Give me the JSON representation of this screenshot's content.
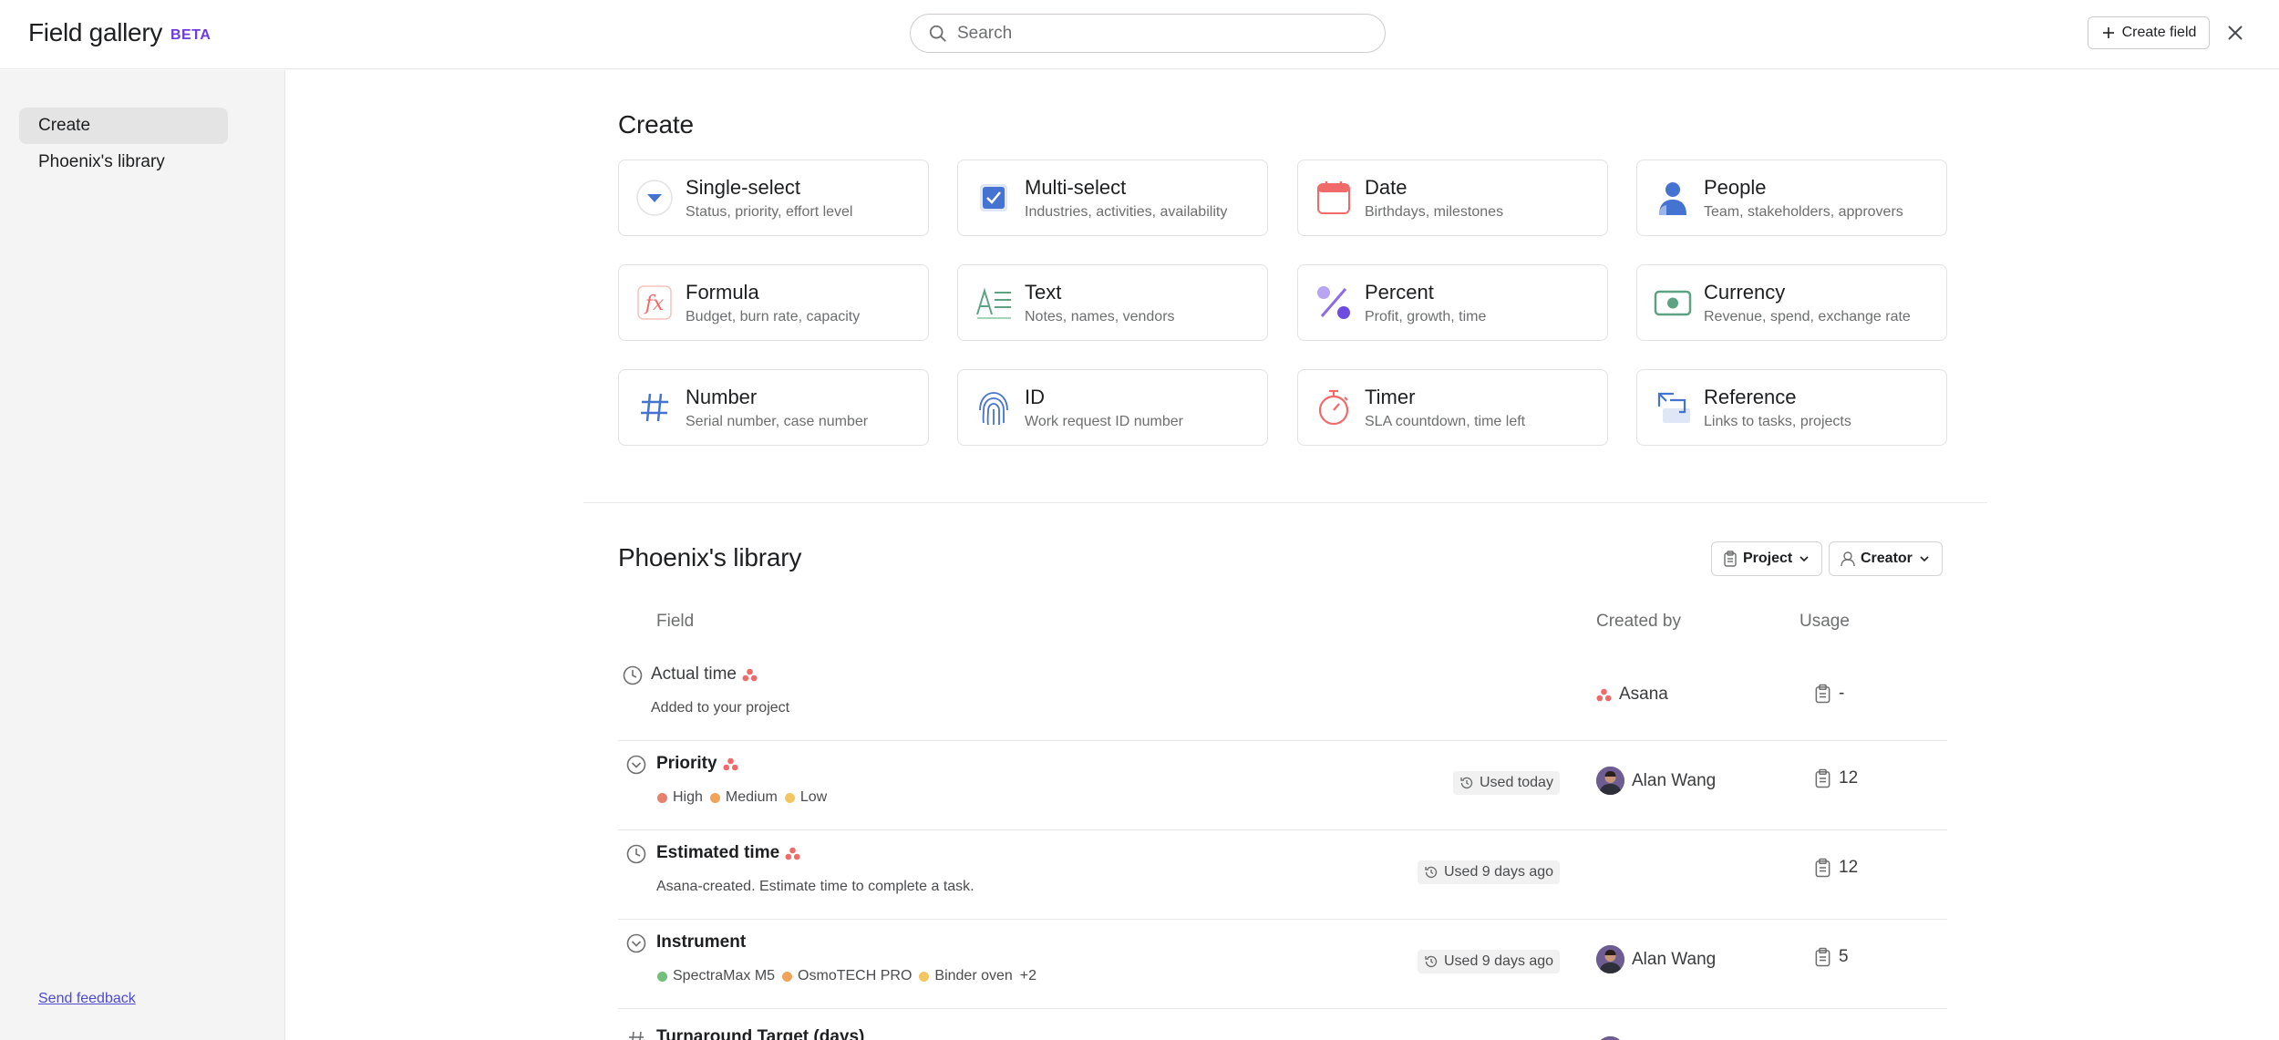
{
  "header": {
    "title": "Field gallery",
    "badge": "BETA",
    "search_placeholder": "Search",
    "create_field_label": "Create field"
  },
  "sidebar": {
    "items": [
      {
        "label": "Create",
        "active": true
      },
      {
        "label": "Phoenix's library",
        "active": false
      }
    ],
    "feedback_label": "Send feedback"
  },
  "create_section": {
    "title": "Create",
    "cards": [
      {
        "name": "Single-select",
        "desc": "Status, priority, effort level",
        "icon": "single-select-icon"
      },
      {
        "name": "Multi-select",
        "desc": "Industries, activities, availability",
        "icon": "multi-select-icon"
      },
      {
        "name": "Date",
        "desc": "Birthdays, milestones",
        "icon": "calendar-icon"
      },
      {
        "name": "People",
        "desc": "Team, stakeholders, approvers",
        "icon": "person-icon"
      },
      {
        "name": "Formula",
        "desc": "Budget, burn rate, capacity",
        "icon": "formula-icon"
      },
      {
        "name": "Text",
        "desc": "Notes, names, vendors",
        "icon": "text-icon"
      },
      {
        "name": "Percent",
        "desc": "Profit, growth, time",
        "icon": "percent-icon"
      },
      {
        "name": "Currency",
        "desc": "Revenue, spend, exchange rate",
        "icon": "currency-icon"
      },
      {
        "name": "Number",
        "desc": "Serial number, case number",
        "icon": "hash-icon"
      },
      {
        "name": "ID",
        "desc": "Work request ID number",
        "icon": "fingerprint-icon"
      },
      {
        "name": "Timer",
        "desc": "SLA countdown, time left",
        "icon": "stopwatch-icon"
      },
      {
        "name": "Reference",
        "desc": "Links to tasks, projects",
        "icon": "reference-icon"
      }
    ]
  },
  "library": {
    "title": "Phoenix's library",
    "filters": {
      "project": "Project",
      "creator": "Creator"
    },
    "columns": {
      "field": "Field",
      "created_by": "Created by",
      "usage": "Usage"
    },
    "rows": [
      {
        "name": "Actual time",
        "sub": "Added to your project",
        "creator": "Asana",
        "usage": "-"
      },
      {
        "name": "Priority",
        "options": [
          {
            "label": "High",
            "color": "#e8806f"
          },
          {
            "label": "Medium",
            "color": "#f1a35a"
          },
          {
            "label": "Low",
            "color": "#f4c65f"
          }
        ],
        "used": "Used today",
        "creator": "Alan Wang",
        "usage": "12"
      },
      {
        "name": "Estimated time",
        "sub": "Asana-created. Estimate time to complete a task.",
        "used": "Used 9 days ago",
        "usage": "12"
      },
      {
        "name": "Instrument",
        "options": [
          {
            "label": "SpectraMax M5",
            "color": "#72c07a"
          },
          {
            "label": "OsmoTECH PRO",
            "color": "#f1a35a"
          },
          {
            "label": "Binder oven",
            "color": "#f4c65f"
          }
        ],
        "more": "+2",
        "used": "Used 9 days ago",
        "creator": "Alan Wang",
        "usage": "5"
      },
      {
        "name": "Turnaround Target (days)"
      }
    ]
  },
  "colors": {
    "asana_coral": "#f06a6a",
    "beta_purple": "#6d3ce0",
    "link_blue": "#4e4ad0"
  }
}
